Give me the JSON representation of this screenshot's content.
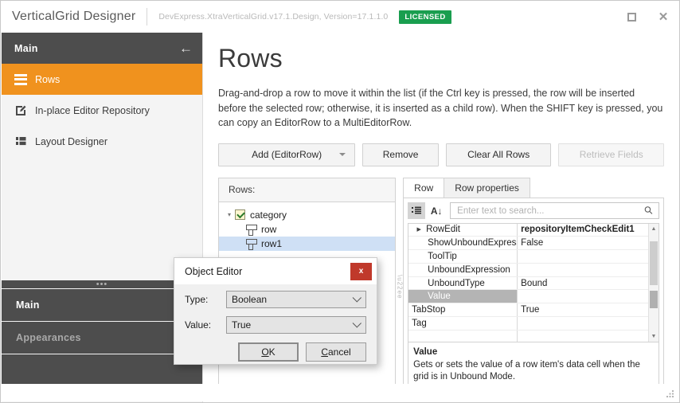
{
  "titlebar": {
    "app_title": "VerticalGrid Designer",
    "assembly": "DevExpress.XtraVerticalGrid.v17.1.Design, Version=17.1.1.0",
    "license_badge": "LICENSED",
    "maximize_icon": "maximize-icon",
    "close_icon": "close-icon",
    "close_glyph": "✕"
  },
  "sidebar": {
    "header_title": "Main",
    "back_glyph": "←",
    "items": [
      {
        "label": "Rows",
        "icon": "rows-icon",
        "active": true
      },
      {
        "label": "In-place Editor Repository",
        "icon": "editor-repository-icon",
        "active": false
      },
      {
        "label": "Layout Designer",
        "icon": "layout-designer-icon",
        "active": false
      }
    ],
    "grip_glyph": "•••",
    "groups": [
      {
        "label": "Main",
        "dim": false
      },
      {
        "label": "Appearances",
        "dim": true
      }
    ]
  },
  "main": {
    "page_title": "Rows",
    "description": "Drag-and-drop a row to move it within the list (if the Ctrl key is pressed, the row will be inserted before the selected row; otherwise, it is inserted as a child row). When the SHIFT key is pressed, you can copy an EditorRow to a MultiEditorRow.",
    "buttons": [
      {
        "label": "Add (EditorRow)",
        "kind": "split",
        "disabled": false
      },
      {
        "label": "Remove",
        "kind": "normal",
        "disabled": false
      },
      {
        "label": "Clear All Rows",
        "kind": "normal",
        "disabled": false
      },
      {
        "label": "Retrieve Fields",
        "kind": "normal",
        "disabled": true
      }
    ]
  },
  "rows_panel": {
    "header": "Rows:",
    "tree": [
      {
        "label": "category",
        "level": 0,
        "icon": "category-row-icon",
        "expander": "▾",
        "selected": false
      },
      {
        "label": "row",
        "level": 1,
        "icon": "editor-row-icon",
        "expander": "",
        "selected": false
      },
      {
        "label": "row1",
        "level": 1,
        "icon": "editor-row-icon",
        "expander": "",
        "selected": true
      }
    ]
  },
  "property_panel": {
    "tabs": [
      {
        "label": "Row",
        "active": true
      },
      {
        "label": "Row properties",
        "active": false
      }
    ],
    "toolbar": {
      "categorized_icon": "categorized-view-icon",
      "categorized_glyph": "≡",
      "alphabetical_icon": "alphabetical-sort-icon",
      "alphabetical_glyph": "A↓",
      "search_placeholder": "Enter text to search...",
      "search_value": "",
      "search_icon": "search-icon",
      "search_glyph": "⚲"
    },
    "rows": [
      {
        "name": "RowEdit",
        "value": "repositoryItemCheckEdit1",
        "indent": true,
        "expander": "▶",
        "bold_value": true,
        "selected": false
      },
      {
        "name": "ShowUnboundExpressi",
        "value": "False",
        "indent": true,
        "expander": "",
        "bold_value": false,
        "selected": false
      },
      {
        "name": "ToolTip",
        "value": "",
        "indent": true,
        "expander": "",
        "bold_value": false,
        "selected": false
      },
      {
        "name": "UnboundExpression",
        "value": "",
        "indent": true,
        "expander": "",
        "bold_value": false,
        "selected": false
      },
      {
        "name": "UnboundType",
        "value": "Bound",
        "indent": true,
        "expander": "",
        "bold_value": false,
        "selected": false
      },
      {
        "name": "Value",
        "value": "",
        "indent": true,
        "expander": "",
        "bold_value": false,
        "selected": true
      },
      {
        "name": "TabStop",
        "value": "True",
        "indent": false,
        "expander": "",
        "bold_value": false,
        "selected": false
      },
      {
        "name": "Tag",
        "value": "",
        "indent": false,
        "expander": "",
        "bold_value": false,
        "selected": false
      }
    ],
    "scroll": {
      "up_glyph": "▲",
      "down_glyph": "▼"
    },
    "description": {
      "title": "Value",
      "text": "Gets or sets the value of a row item's data cell when the grid is in Unbound Mode."
    }
  },
  "dialog": {
    "title": "Object Editor",
    "close_glyph": "x",
    "close_icon": "dialog-close-icon",
    "fields": [
      {
        "label": "Type:",
        "value": "Boolean"
      },
      {
        "label": "Value:",
        "value": "True"
      }
    ],
    "ok_label": "OK",
    "ok_accel": "O",
    "ok_rest": "K",
    "cancel_accel": "C",
    "cancel_rest": "ancel",
    "cancel_label": "Cancel"
  },
  "statusbar": {
    "resize_grip_icon": "resize-grip-icon"
  }
}
